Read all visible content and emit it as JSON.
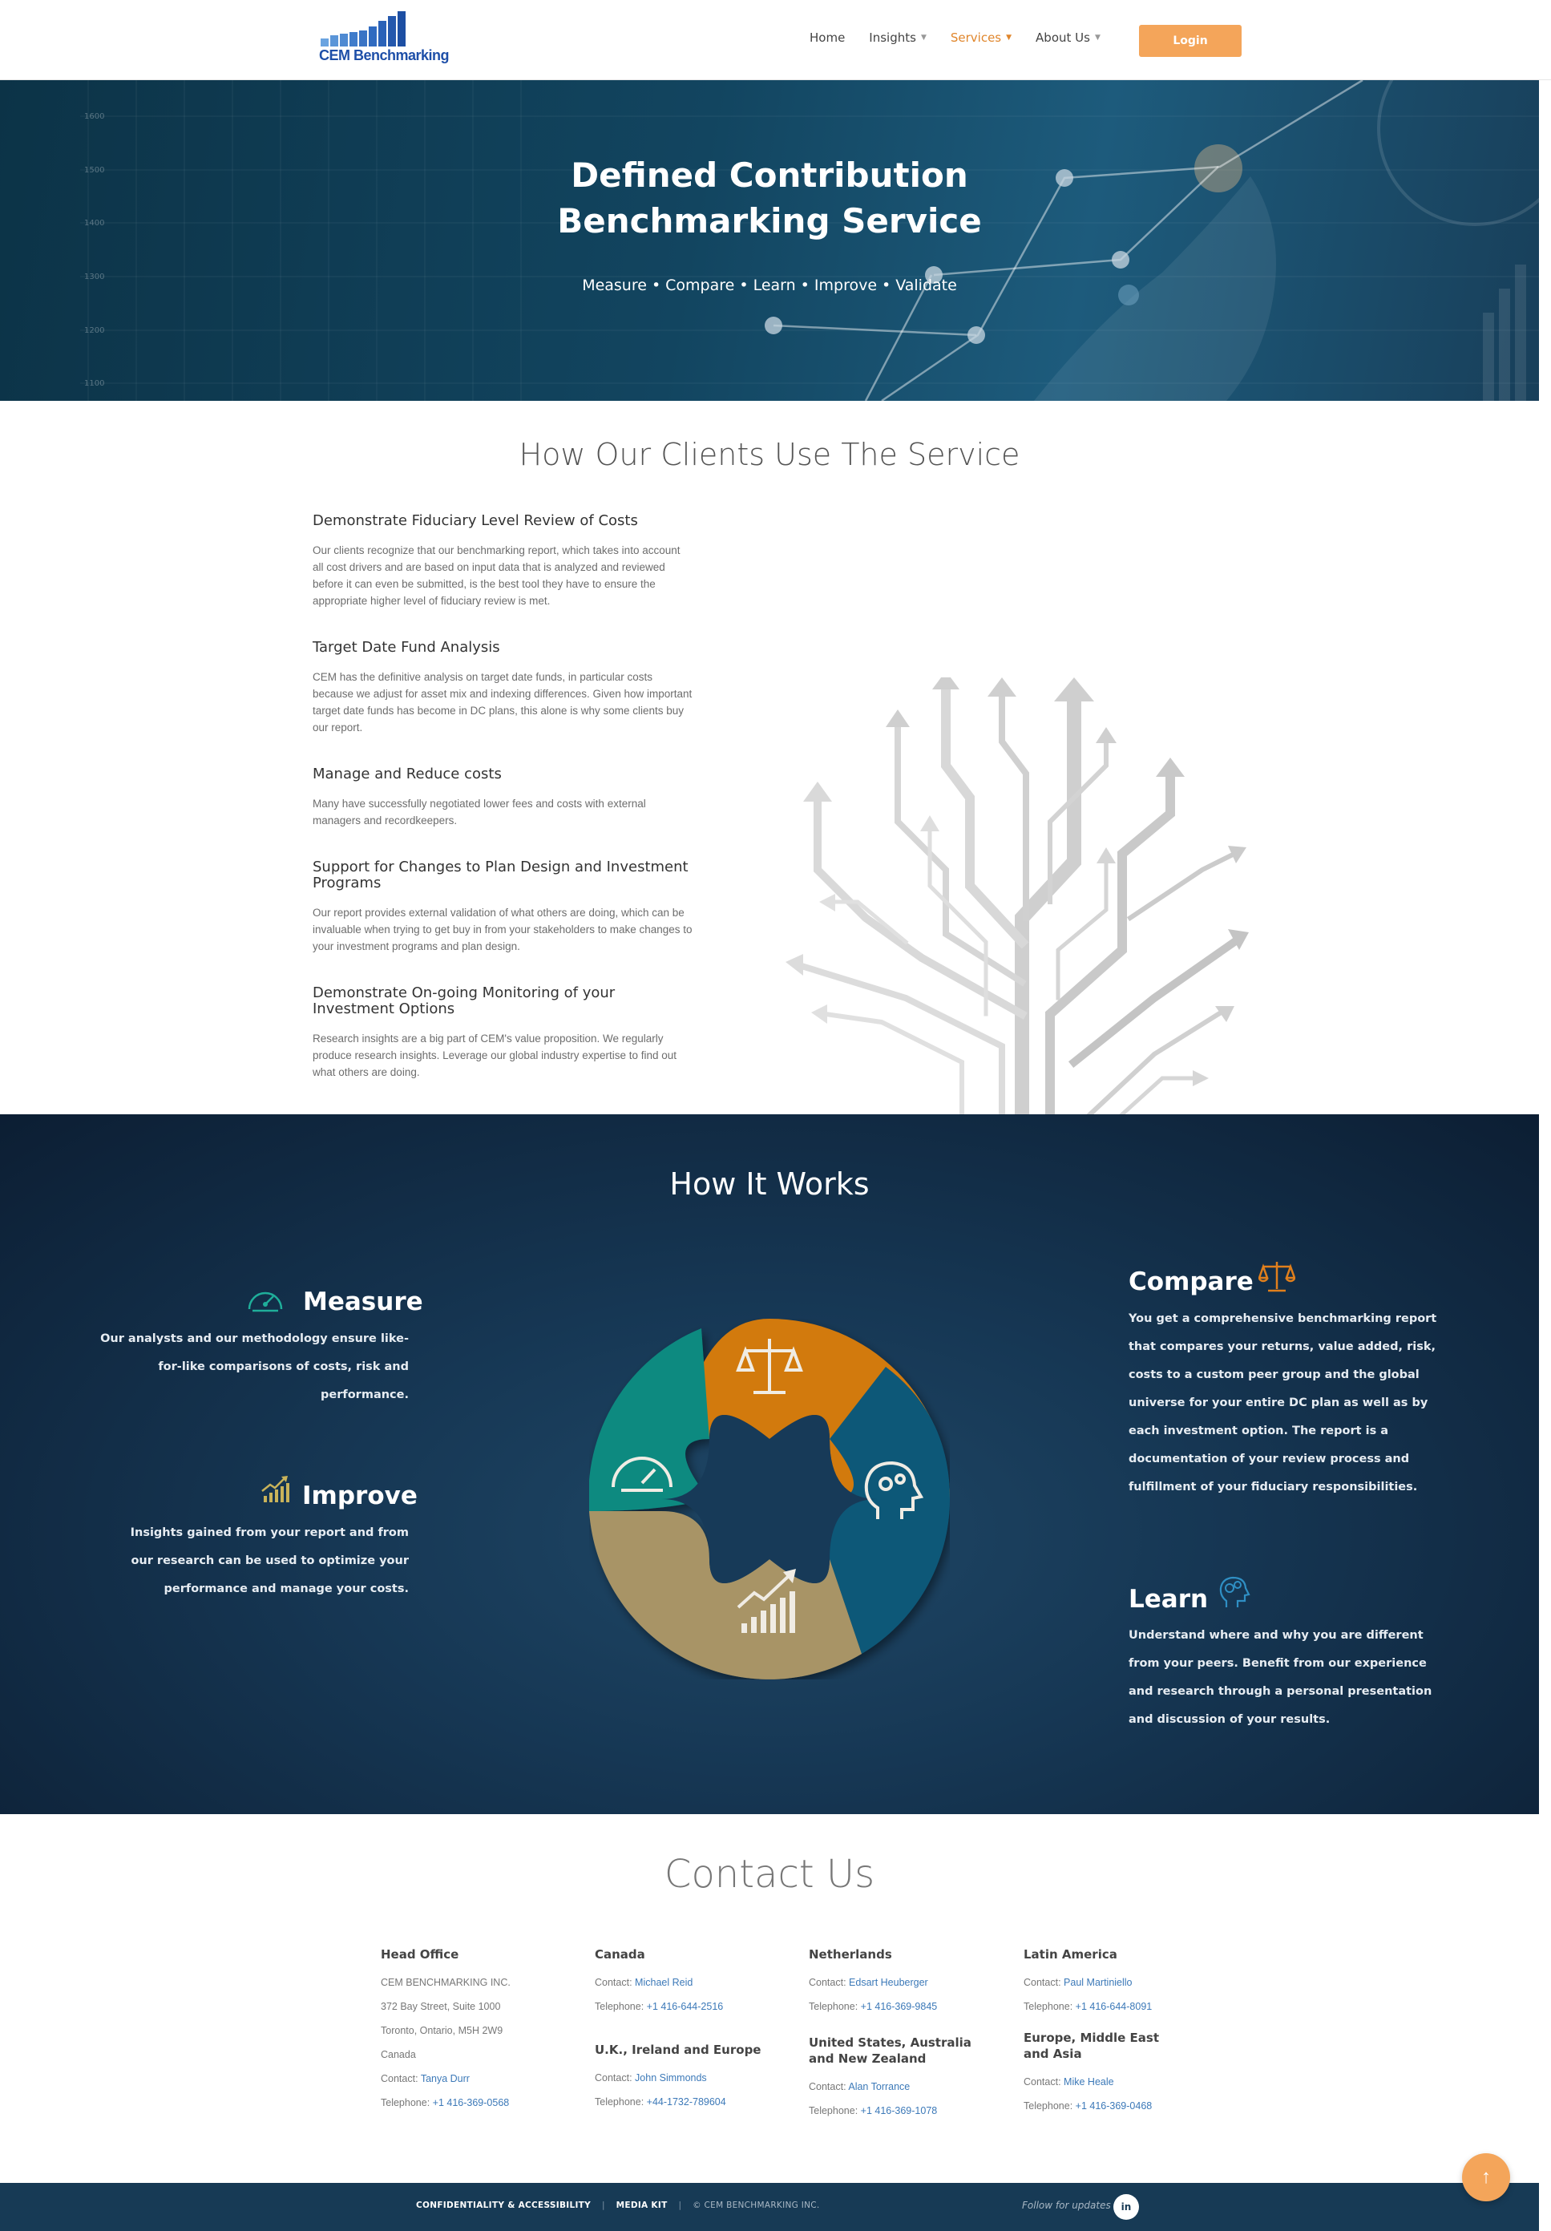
{
  "header": {
    "logo_text": "CEM Benchmarking",
    "nav": [
      {
        "label": "Home",
        "has_dropdown": false,
        "active": false
      },
      {
        "label": "Insights",
        "has_dropdown": true,
        "active": false
      },
      {
        "label": "Services",
        "has_dropdown": true,
        "active": true
      },
      {
        "label": "About Us",
        "has_dropdown": true,
        "active": false
      }
    ],
    "login_label": "Login",
    "accent_color": "#f4a55a",
    "active_color": "#e0862c"
  },
  "hero": {
    "title_line1": "Defined Contribution",
    "title_line2": "Benchmarking Service",
    "tagline": [
      "Measure",
      "Compare",
      "Learn",
      "Improve",
      "Validate"
    ],
    "axis_ticks": [
      "1600",
      "1500",
      "1400",
      "1300",
      "1200",
      "1100"
    ]
  },
  "uses": {
    "title": "How Our Clients Use The Service",
    "items": [
      {
        "title": "Demonstrate Fiduciary Level Review of Costs",
        "text": "Our clients recognize that our benchmarking report, which takes into account all cost drivers and are based on input data that is analyzed and reviewed before it can even be submitted, is the best tool they have to ensure the appropriate higher level of fiduciary review is met."
      },
      {
        "title": "Target Date Fund Analysis",
        "text": "CEM has the definitive analysis on target date funds, in particular costs because we adjust for asset mix and indexing differences. Given how important target date funds has become in DC plans, this alone is why some clients buy our report."
      },
      {
        "title": "Manage and Reduce costs",
        "text": "Many have successfully negotiated lower fees and costs with external managers and recordkeepers."
      },
      {
        "title": "Support for Changes to Plan Design and Investment Programs",
        "text": "Our report provides external validation of what others are doing, which can be invaluable when trying to get buy in from your stakeholders to make changes to your investment programs and plan design."
      },
      {
        "title": "Demonstrate On-going Monitoring of your Investment Options",
        "text": "Research insights are a big part of CEM's value proposition. We regularly produce research insights. Leverage our global industry expertise to find out what others are doing."
      }
    ]
  },
  "how": {
    "title": "How It Works",
    "measure": {
      "title": "Measure",
      "text": "Our analysts and our methodology ensure like-for-like comparisons of costs, risk and performance.",
      "icon": "speedometer-icon",
      "color": "#1fae9a"
    },
    "improve": {
      "title": "Improve",
      "text": "Insights gained from your report and from our research can be used to optimize your performance and manage your costs.",
      "icon": "growth-chart-icon",
      "color": "#c9b35a"
    },
    "compare": {
      "title": "Compare",
      "text": "You get a comprehensive benchmarking report that compares your returns, value added, risk, costs to a custom peer group and the global universe for your entire DC plan as well as by each investment option. The report is a documentation of your review process and fulfillment of your fiduciary responsibilities.",
      "icon": "scales-icon",
      "color": "#e07f1c"
    },
    "learn": {
      "title": "Learn",
      "text": "Understand where and why you are different from your peers. Benefit from our experience and research through a personal presentation and discussion of your results.",
      "icon": "head-gears-icon",
      "color": "#2f8fc4"
    },
    "wheel_colors": {
      "compare": "#d27a10",
      "learn": "#0f5878",
      "improve": "#a89466",
      "measure": "#0d8a80"
    }
  },
  "contact": {
    "title": "Contact Us",
    "offices": [
      {
        "id": "head",
        "name": "Head Office",
        "lines": [
          "CEM BENCHMARKING INC.",
          "372 Bay Street, Suite 1000",
          "Toronto, Ontario, M5H 2W9",
          "Canada"
        ],
        "contact": "Tanya Durr",
        "telephone": "+1 416-369-0568"
      },
      {
        "id": "canada",
        "name": "Canada",
        "contact": "Michael Reid",
        "telephone": "+1 416-644-2516"
      },
      {
        "id": "uk",
        "name": "U.K., Ireland and Europe",
        "contact": "John Simmonds",
        "telephone": "+44-1732-789604"
      },
      {
        "id": "netherlands",
        "name": "Netherlands",
        "contact": "Edsart Heuberger",
        "telephone": "+1 416-369-9845"
      },
      {
        "id": "us",
        "name": "United States, Australia and New Zealand",
        "contact": "Alan Torrance",
        "telephone": "+1 416-369-1078"
      },
      {
        "id": "latam",
        "name": "Latin America",
        "contact": "Paul Martiniello",
        "telephone": "+1 416-644-8091"
      },
      {
        "id": "emea",
        "name": "Europe, Middle East and Asia",
        "contact": "Mike Heale",
        "telephone": "+1 416-369-0468"
      }
    ],
    "contact_label": "Contact:",
    "telephone_label": "Telephone:"
  },
  "footer": {
    "links": [
      "CONFIDENTIALITY & ACCESSIBILITY",
      "MEDIA KIT"
    ],
    "copyright": "© CEM BENCHMARKING INC.",
    "follow": "Follow for updates",
    "social": "in"
  },
  "back_to_top_icon": "arrow-up-icon"
}
